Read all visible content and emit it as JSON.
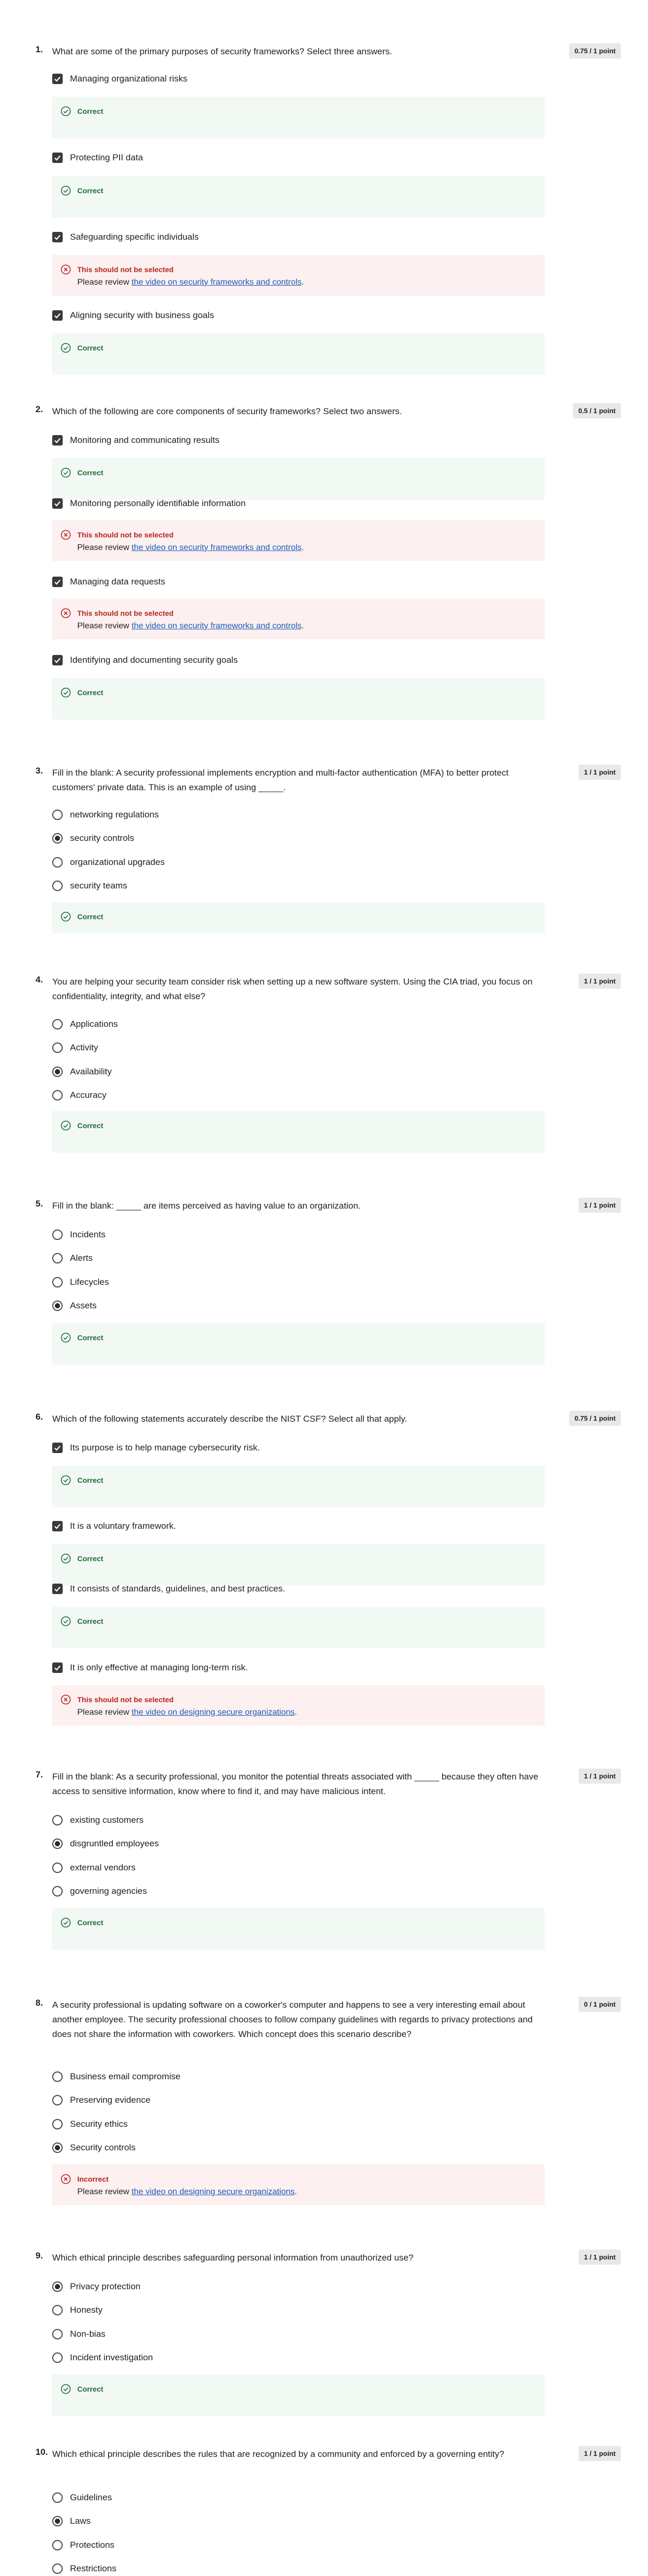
{
  "questions": [
    {
      "num": "1.",
      "text": "What are some of the primary purposes of security frameworks? Select three answers.",
      "score": "0.75 / 1 point",
      "options": [
        {
          "label": "Managing organizational risks",
          "feedback": {
            "title": "Correct"
          }
        },
        {
          "label": "Protecting PII data",
          "feedback": {
            "title": "Correct"
          }
        },
        {
          "label": "Safeguarding specific individuals",
          "feedback": {
            "title": "This should not be selected",
            "review_prefix": "Please review ",
            "review_link": "the video on security frameworks and controls",
            "review_suffix": "."
          }
        },
        {
          "label": "Aligning security with business goals",
          "feedback": {
            "title": "Correct"
          }
        }
      ]
    },
    {
      "num": "2.",
      "text": "Which of the following are core components of security frameworks? Select two answers.",
      "score": "0.5 / 1 point",
      "options": [
        {
          "label": "Monitoring and communicating results",
          "feedback": {
            "title": "Correct"
          }
        },
        {
          "label": "Monitoring personally identifiable information",
          "feedback": {
            "title": "This should not be selected",
            "review_prefix": "Please review ",
            "review_link": "the video on security frameworks and controls",
            "review_suffix": "."
          }
        },
        {
          "label": "Managing data requests",
          "feedback": {
            "title": "This should not be selected",
            "review_prefix": "Please review ",
            "review_link": "the video on security frameworks and controls",
            "review_suffix": "."
          }
        },
        {
          "label": "Identifying and documenting security goals",
          "feedback": {
            "title": "Correct"
          }
        }
      ]
    },
    {
      "num": "3.",
      "text": "Fill in the blank: A security professional implements encryption and multi-factor authentication (MFA) to better protect customers' private data. This is an example of using _____.",
      "score": "1 / 1 point",
      "options": [
        {
          "label": "networking regulations"
        },
        {
          "label": "security controls"
        },
        {
          "label": "organizational upgrades"
        },
        {
          "label": "security teams"
        }
      ],
      "feedback": {
        "title": "Correct"
      }
    },
    {
      "num": "4.",
      "text": "You are helping your security team consider risk when setting up a new software system. Using  the CIA triad, you focus on confidentiality, integrity, and what else?",
      "score": "1 / 1 point",
      "options": [
        {
          "label": "Applications"
        },
        {
          "label": "Activity"
        },
        {
          "label": "Availability"
        },
        {
          "label": "Accuracy"
        }
      ],
      "feedback": {
        "title": "Correct"
      }
    },
    {
      "num": "5.",
      "text": "Fill in the blank: _____ are items perceived as having value to an organization.",
      "score": "1 / 1 point",
      "options": [
        {
          "label": "Incidents"
        },
        {
          "label": "Alerts"
        },
        {
          "label": "Lifecycles"
        },
        {
          "label": "Assets"
        }
      ],
      "feedback": {
        "title": "Correct"
      }
    },
    {
      "num": "6.",
      "text": "Which of the following statements accurately describe the NIST CSF? Select all that apply.",
      "score": "0.75 / 1 point",
      "options": [
        {
          "label": "Its purpose is to help manage cybersecurity risk.",
          "feedback": {
            "title": "Correct"
          }
        },
        {
          "label": "It is a voluntary framework.",
          "feedback": {
            "title": "Correct"
          }
        },
        {
          "label": "It consists of standards, guidelines, and best practices.",
          "feedback": {
            "title": "Correct"
          }
        },
        {
          "label": "It is only effective at managing long-term risk.",
          "feedback": {
            "title": "This should not be selected",
            "review_prefix": "Please review ",
            "review_link": "the video on designing secure organizations",
            "review_suffix": "."
          }
        }
      ]
    },
    {
      "num": "7.",
      "text": "Fill in the blank: As a security professional, you monitor the potential threats associated with _____ because they often have access to sensitive information, know where to find it, and may have malicious intent.",
      "score": "1 / 1 point",
      "options": [
        {
          "label": "existing customers"
        },
        {
          "label": "disgruntled employees"
        },
        {
          "label": "external vendors"
        },
        {
          "label": "governing agencies"
        }
      ],
      "feedback": {
        "title": "Correct"
      }
    },
    {
      "num": "8.",
      "text": "A security professional is updating software on a coworker's computer and happens to see a very interesting email about another employee. The security professional chooses to follow company guidelines with regards to privacy protections and does not share the information with coworkers. Which concept does this scenario describe?",
      "score": "0 / 1 point",
      "options": [
        {
          "label": "Business email compromise"
        },
        {
          "label": "Preserving evidence"
        },
        {
          "label": "Security ethics"
        },
        {
          "label": "Security controls"
        }
      ],
      "feedback": {
        "title": "Incorrect",
        "review_prefix": "Please review ",
        "review_link": "the video on designing secure organizations",
        "review_suffix": "."
      }
    },
    {
      "num": "9.",
      "text": "Which ethical principle describes safeguarding personal information from unauthorized use?",
      "score": "1 / 1 point",
      "options": [
        {
          "label": "Privacy protection"
        },
        {
          "label": "Honesty"
        },
        {
          "label": "Non-bias"
        },
        {
          "label": "Incident investigation"
        }
      ],
      "feedback": {
        "title": "Correct"
      }
    },
    {
      "num": "10.",
      "text": "Which ethical principle describes the rules that are recognized by a community and enforced by a governing entity?",
      "score": "1 / 1 point",
      "options": [
        {
          "label": "Guidelines"
        },
        {
          "label": "Laws"
        },
        {
          "label": "Protections"
        },
        {
          "label": "Restrictions"
        }
      ]
    }
  ],
  "icons": {
    "check": "checkmark-icon",
    "correct": "check-circle-icon",
    "wrong": "x-circle-icon"
  },
  "colors": {
    "correct": "#1d6b37",
    "wrong": "#b3261e",
    "link": "#1a5bb8"
  }
}
